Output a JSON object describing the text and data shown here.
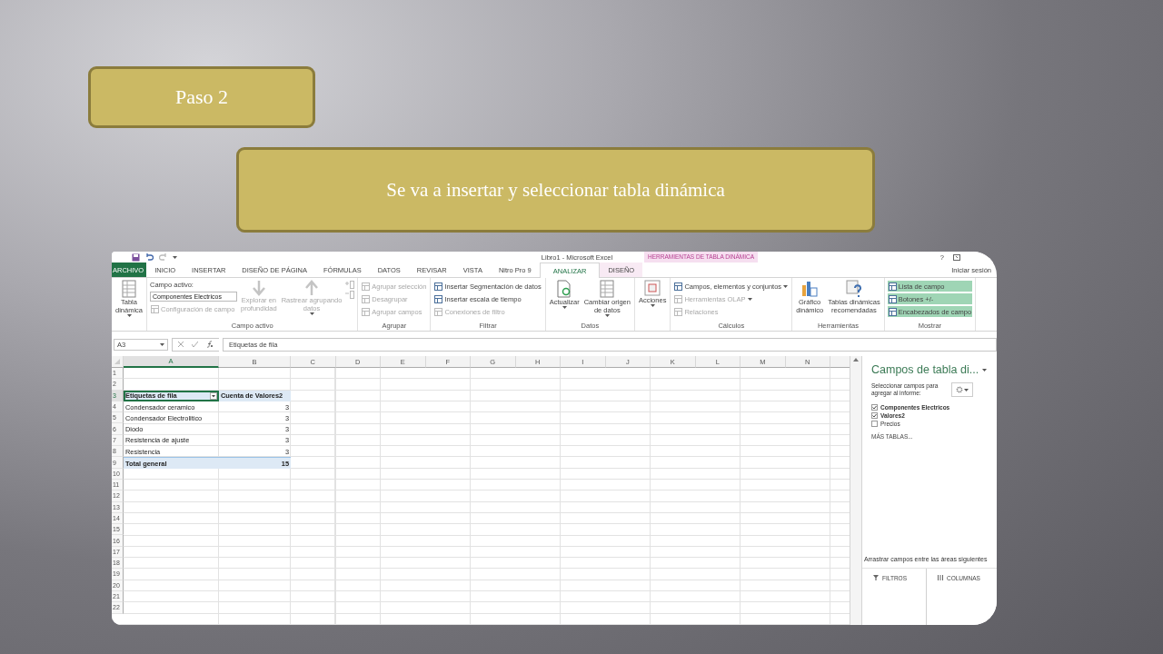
{
  "slide": {
    "title": "Paso 2",
    "subtitle": "Se va a insertar y seleccionar tabla dinámica"
  },
  "excel": {
    "window_title": "Libro1 - Microsoft Excel",
    "context_group": "HERRAMIENTAS DE TABLA DINÁMICA",
    "help": "?",
    "sign_in": "Iniciar sesión",
    "tabs": [
      {
        "label": "ARCHIVO",
        "kind": "file",
        "selected": false
      },
      {
        "label": "INICIO",
        "kind": "tab",
        "selected": false
      },
      {
        "label": "INSERTAR",
        "kind": "tab",
        "selected": false
      },
      {
        "label": "DISEÑO DE PÁGINA",
        "kind": "tab",
        "selected": false
      },
      {
        "label": "FÓRMULAS",
        "kind": "tab",
        "selected": false
      },
      {
        "label": "DATOS",
        "kind": "tab",
        "selected": false
      },
      {
        "label": "REVISAR",
        "kind": "tab",
        "selected": false
      },
      {
        "label": "VISTA",
        "kind": "tab",
        "selected": false
      },
      {
        "label": "Nitro Pro 9",
        "kind": "tab",
        "selected": false
      },
      {
        "label": "ANALIZAR",
        "kind": "context",
        "selected": true
      },
      {
        "label": "DISEÑO",
        "kind": "context",
        "selected": false
      }
    ],
    "ribbon_groups": [
      {
        "items": [
          {
            "kind": "large",
            "label": "Tabla\ndinámica",
            "disabled": false,
            "dropdown": true
          }
        ]
      },
      {
        "label": "Campo activo",
        "items": [
          {
            "kind": "caption",
            "label": "Campo activo:"
          },
          {
            "kind": "field",
            "value": "Componentes Electricos"
          },
          {
            "kind": "small",
            "label": "Configuración de campo",
            "disabled": true,
            "dropdown": false
          },
          {
            "kind": "large",
            "label": "Explorar en\nprofundidad",
            "disabled": true,
            "dropdown": false
          },
          {
            "kind": "large",
            "label": "Rastrear agrupando\ndatos",
            "disabled": true,
            "dropdown": true
          },
          {
            "kind": "icon",
            "disabled": true
          },
          {
            "kind": "icon",
            "disabled": true
          }
        ]
      },
      {
        "label": "Agrupar",
        "items": [
          {
            "kind": "small",
            "label": "Agrupar selección",
            "disabled": true,
            "dropdown": false
          },
          {
            "kind": "small",
            "label": "Desagrupar",
            "disabled": true,
            "dropdown": false
          },
          {
            "kind": "small",
            "label": "Agrupar campos",
            "disabled": true,
            "dropdown": false
          }
        ]
      },
      {
        "label": "Filtrar",
        "items": [
          {
            "kind": "small",
            "label": "Insertar Segmentación de datos",
            "disabled": false,
            "dropdown": false
          },
          {
            "kind": "small",
            "label": "Insertar escala de tiempo",
            "disabled": false,
            "dropdown": false
          },
          {
            "kind": "small",
            "label": "Conexiones de filtro",
            "disabled": true,
            "dropdown": false
          }
        ]
      },
      {
        "label": "Datos",
        "items": [
          {
            "kind": "large",
            "label": "Actualizar",
            "disabled": false,
            "dropdown": true
          },
          {
            "kind": "large",
            "label": "Cambiar origen\nde datos",
            "disabled": false,
            "dropdown": true
          }
        ]
      },
      {
        "items": [
          {
            "kind": "large",
            "label": "Acciones",
            "disabled": false,
            "dropdown": true
          }
        ]
      },
      {
        "label": "Cálculos",
        "items": [
          {
            "kind": "small",
            "label": "Campos, elementos y conjuntos",
            "disabled": false,
            "dropdown": true
          },
          {
            "kind": "small",
            "label": "Herramientas OLAP",
            "disabled": true,
            "dropdown": true
          },
          {
            "kind": "small",
            "label": "Relaciones",
            "disabled": true,
            "dropdown": false
          }
        ]
      },
      {
        "label": "Herramientas",
        "items": [
          {
            "kind": "large",
            "label": "Gráfico\ndinámico",
            "disabled": false,
            "dropdown": false
          },
          {
            "kind": "large",
            "label": "Tablas dinámicas\nrecomendadas",
            "disabled": false,
            "dropdown": false
          }
        ]
      },
      {
        "label": "Mostrar",
        "items": [
          {
            "kind": "toggle",
            "label": "Lista de campo",
            "on": true
          },
          {
            "kind": "toggle",
            "label": "Botones +/-",
            "on": true
          },
          {
            "kind": "toggle",
            "label": "Encabezados de campo",
            "on": true
          }
        ]
      }
    ],
    "name_box": "A3",
    "formula": "Etiquetas de fila",
    "columns": [
      {
        "label": "A",
        "selected": true
      },
      {
        "label": "B",
        "selected": false
      },
      {
        "label": "C",
        "selected": false
      },
      {
        "label": "D",
        "selected": false
      },
      {
        "label": "E",
        "selected": false
      },
      {
        "label": "F",
        "selected": false
      },
      {
        "label": "G",
        "selected": false
      },
      {
        "label": "H",
        "selected": false
      },
      {
        "label": "I",
        "selected": false
      },
      {
        "label": "J",
        "selected": false
      },
      {
        "label": "K",
        "selected": false
      },
      {
        "label": "L",
        "selected": false
      },
      {
        "label": "M",
        "selected": false
      },
      {
        "label": "N",
        "selected": false
      }
    ],
    "rows": [
      {
        "number": "1",
        "kind": "plain",
        "selected": false
      },
      {
        "number": "2",
        "kind": "plain",
        "selected": false
      },
      {
        "number": "3",
        "kind": "header",
        "selected": true,
        "cells": [
          {
            "text": "Etiquetas de fila",
            "selected": true
          },
          {
            "text": "Cuenta de Valores2",
            "selected": false
          }
        ]
      },
      {
        "number": "4",
        "kind": "item",
        "selected": false,
        "cells": [
          {
            "text": "Condensador ceramico",
            "selected": false
          },
          {
            "text": "3",
            "selected": false
          }
        ]
      },
      {
        "number": "5",
        "kind": "item",
        "selected": false,
        "cells": [
          {
            "text": "Condensador Electrolitico",
            "selected": false
          },
          {
            "text": "3",
            "selected": false
          }
        ]
      },
      {
        "number": "6",
        "kind": "item",
        "selected": false,
        "cells": [
          {
            "text": "Diodo",
            "selected": false
          },
          {
            "text": "3",
            "selected": false
          }
        ]
      },
      {
        "number": "7",
        "kind": "item",
        "selected": false,
        "cells": [
          {
            "text": "Resistencia de ajuste",
            "selected": false
          },
          {
            "text": "3",
            "selected": false
          }
        ]
      },
      {
        "number": "8",
        "kind": "item",
        "selected": false,
        "cells": [
          {
            "text": "Resistencia",
            "selected": false
          },
          {
            "text": "3",
            "selected": false
          }
        ]
      },
      {
        "number": "9",
        "kind": "total",
        "selected": false,
        "cells": [
          {
            "text": "Total general",
            "selected": false
          },
          {
            "text": "15",
            "selected": false
          }
        ]
      },
      {
        "number": "10",
        "kind": "plain",
        "selected": false
      },
      {
        "number": "11",
        "kind": "plain",
        "selected": false
      },
      {
        "number": "12",
        "kind": "plain",
        "selected": false
      },
      {
        "number": "13",
        "kind": "plain",
        "selected": false
      },
      {
        "number": "14",
        "kind": "plain",
        "selected": false
      },
      {
        "number": "15",
        "kind": "plain",
        "selected": false
      },
      {
        "number": "16",
        "kind": "plain",
        "selected": false
      },
      {
        "number": "17",
        "kind": "plain",
        "selected": false
      },
      {
        "number": "18",
        "kind": "plain",
        "selected": false
      },
      {
        "number": "19",
        "kind": "plain",
        "selected": false
      },
      {
        "number": "20",
        "kind": "plain",
        "selected": false
      },
      {
        "number": "21",
        "kind": "plain",
        "selected": false
      },
      {
        "number": "22",
        "kind": "plain",
        "selected": false
      }
    ],
    "field_list": {
      "title": "Campos de tabla di...",
      "prompt": "Seleccionar campos para agregar al informe:",
      "fields": [
        {
          "label": "Componentes Electricos",
          "checked": true
        },
        {
          "label": "Valores2",
          "checked": true
        },
        {
          "label": "Precios",
          "checked": false
        }
      ],
      "more_tables": "MÁS TABLAS...",
      "drag_hint": "Arrastrar campos entre las áreas siguientes",
      "areas": [
        {
          "label": "FILTROS",
          "kind": "filters"
        },
        {
          "label": "COLUMNAS",
          "kind": "columns"
        }
      ]
    }
  }
}
